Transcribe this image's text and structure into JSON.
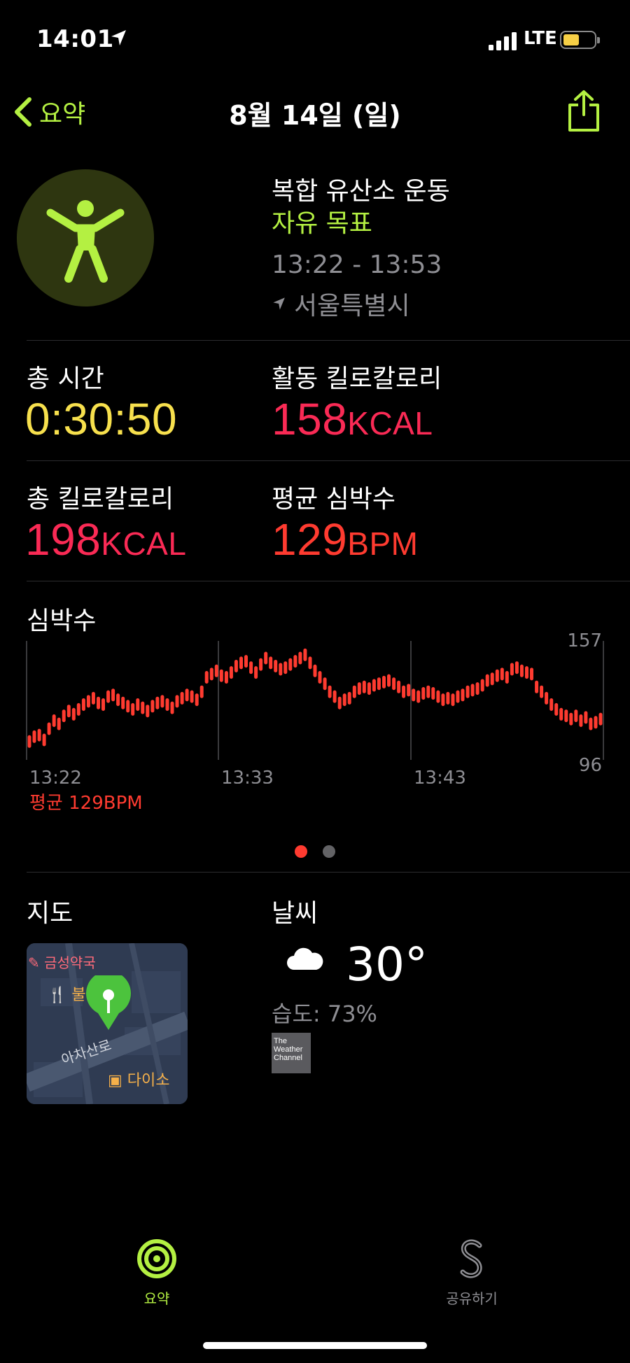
{
  "status": {
    "time": "14:01",
    "network": "LTE",
    "battery_color": "#f7d046"
  },
  "nav": {
    "back_label": "요약",
    "title": "8월 14일 (일)"
  },
  "workout": {
    "name": "복합 유산소 운동",
    "goal": "자유 목표",
    "time_range": "13:22 - 13:53",
    "location": "서울특별시",
    "icon": "figure-activity-icon"
  },
  "metrics": {
    "total_time": {
      "label": "총 시간",
      "value": "0:30:50"
    },
    "active_kcal": {
      "label": "활동 킬로칼로리",
      "value": "158",
      "unit": "KCAL"
    },
    "total_kcal": {
      "label": "총 킬로칼로리",
      "value": "198",
      "unit": "KCAL"
    },
    "avg_hr": {
      "label": "평균 심박수",
      "value": "129",
      "unit": "BPM"
    }
  },
  "heart_rate": {
    "title": "심박수",
    "average_label": "평균 129BPM",
    "chart_data": {
      "type": "scatter",
      "x_ticks": [
        "13:22",
        "13:33",
        "13:43"
      ],
      "ylim": [
        96,
        157
      ],
      "y_labels": [
        "157",
        "96"
      ],
      "color": "#ff3b30",
      "values": [
        100,
        103,
        104,
        101,
        108,
        113,
        111,
        116,
        119,
        117,
        120,
        123,
        125,
        127,
        124,
        123,
        128,
        129,
        126,
        124,
        122,
        120,
        123,
        121,
        119,
        122,
        124,
        125,
        123,
        121,
        125,
        127,
        129,
        128,
        126,
        131,
        140,
        142,
        144,
        141,
        140,
        143,
        147,
        149,
        150,
        146,
        143,
        148,
        152,
        149,
        147,
        145,
        146,
        148,
        150,
        152,
        154,
        149,
        144,
        140,
        136,
        131,
        128,
        124,
        126,
        127,
        131,
        133,
        134,
        133,
        135,
        136,
        137,
        138,
        136,
        134,
        131,
        132,
        129,
        128,
        130,
        131,
        130,
        128,
        126,
        127,
        126,
        128,
        129,
        131,
        132,
        133,
        135,
        138,
        139,
        141,
        142,
        140,
        145,
        146,
        144,
        143,
        142,
        134,
        131,
        127,
        123,
        120,
        117,
        116,
        114,
        116,
        113,
        115,
        111,
        112,
        114
      ]
    }
  },
  "pager": {
    "active_color": "#ff3b30",
    "inactive_color": "#636366"
  },
  "map": {
    "title": "지도",
    "labels": {
      "pharmacy": "금성약국",
      "restaurant": "불",
      "road": "아차산로",
      "store": "다이소"
    }
  },
  "weather": {
    "title": "날씨",
    "temperature": "30°",
    "humidity": "습도: 73%",
    "icon": "cloud-icon",
    "provider": "The Weather Channel"
  },
  "tabs": [
    {
      "label": "요약",
      "icon": "summary-rings-icon",
      "active": true
    },
    {
      "label": "공유하기",
      "icon": "sharing-icon",
      "active": false
    }
  ]
}
